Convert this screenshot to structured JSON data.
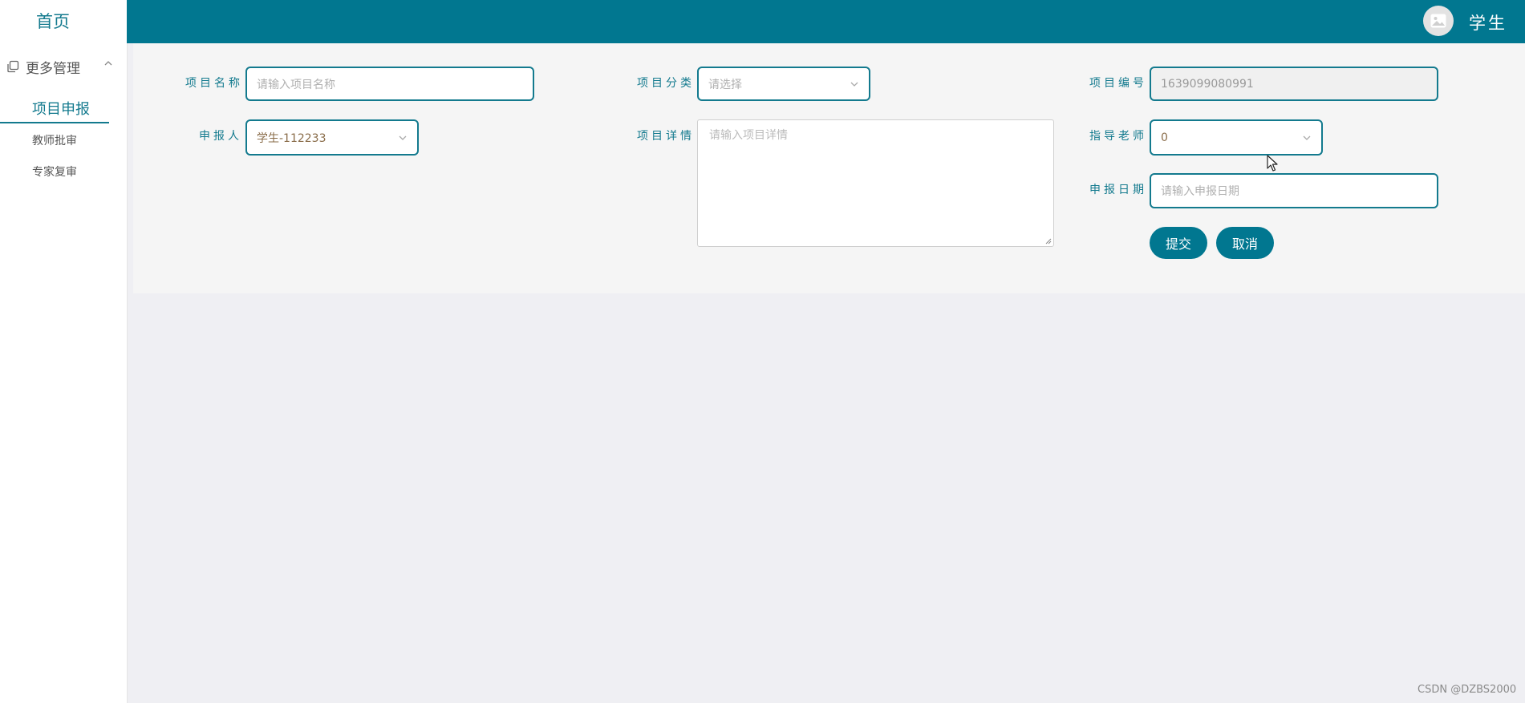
{
  "sidebar": {
    "home": "首页",
    "group": {
      "label": "更多管理",
      "icon": "copy-icon",
      "expanded": true
    },
    "items": [
      {
        "label": "项目申报",
        "active": true
      },
      {
        "label": "教师批审",
        "active": false
      },
      {
        "label": "专家复审",
        "active": false
      }
    ]
  },
  "header": {
    "user_name": "学生",
    "avatar_icon": "image-icon",
    "bar_color": "#017790"
  },
  "form": {
    "project_name": {
      "label": "项目名称",
      "placeholder": "请输入项目名称",
      "value": ""
    },
    "project_category": {
      "label": "项目分类",
      "placeholder": "请选择",
      "value": ""
    },
    "project_number": {
      "label": "项目编号",
      "value": "1639099080991",
      "readonly": true
    },
    "applicant": {
      "label": "申报人",
      "value": "学生-112233"
    },
    "project_detail": {
      "label": "项目详情",
      "placeholder": "请输入项目详情",
      "value": ""
    },
    "advisor": {
      "label": "指导老师",
      "value": "0"
    },
    "apply_date": {
      "label": "申报日期",
      "placeholder": "请输入申报日期",
      "value": ""
    },
    "submit_label": "提交",
    "cancel_label": "取消"
  },
  "watermark": "CSDN @DZBS2000",
  "colors": {
    "accent": "#137a8e",
    "bar": "#017790",
    "background": "#efeff3"
  }
}
